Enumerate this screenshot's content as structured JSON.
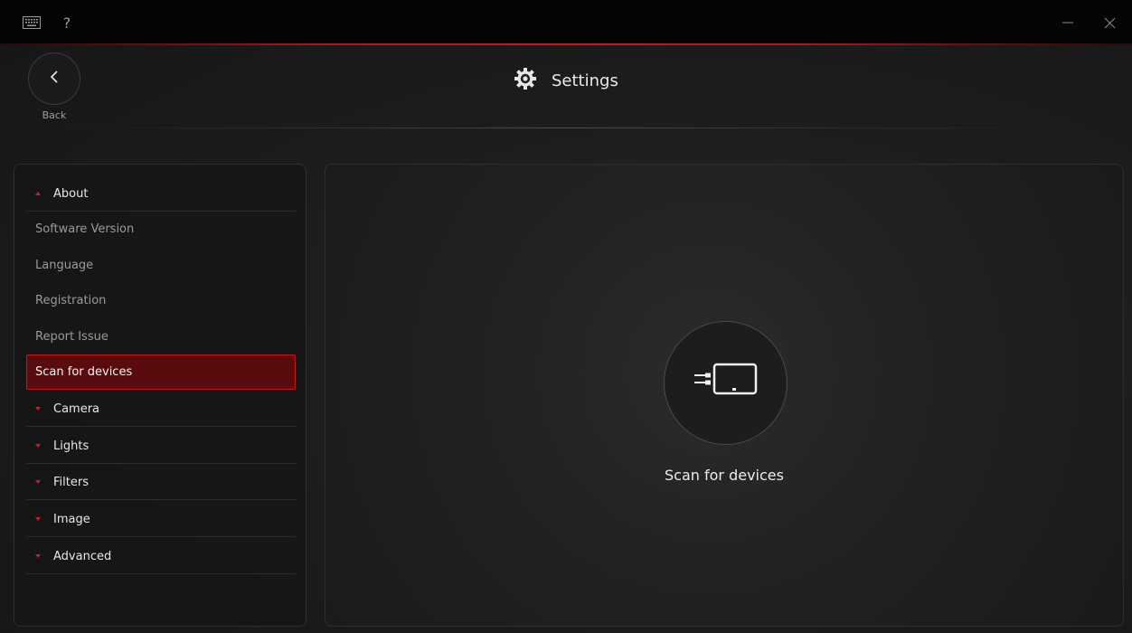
{
  "titlebar": {
    "keyboard_icon": "keyboard-icon",
    "help_glyph": "?",
    "accent_color": "#c81b22"
  },
  "header": {
    "back_label": "Back",
    "title": "Settings"
  },
  "sidebar": {
    "items": [
      {
        "label": "About",
        "kind": "section",
        "expanded": true
      },
      {
        "label": "Software Version",
        "kind": "sub"
      },
      {
        "label": "Language",
        "kind": "sub"
      },
      {
        "label": "Registration",
        "kind": "sub"
      },
      {
        "label": "Report Issue",
        "kind": "sub"
      },
      {
        "label": "Scan for devices",
        "kind": "sub",
        "active": true
      },
      {
        "label": "Camera",
        "kind": "section",
        "expanded": false
      },
      {
        "label": "Lights",
        "kind": "section",
        "expanded": false
      },
      {
        "label": "Filters",
        "kind": "section",
        "expanded": false
      },
      {
        "label": "Image",
        "kind": "section",
        "expanded": false
      },
      {
        "label": "Advanced",
        "kind": "section",
        "expanded": false
      }
    ]
  },
  "main": {
    "scan_label": "Scan for devices",
    "scan_icon": "device-scan-icon"
  },
  "colors": {
    "accent": "#c81b22",
    "active_bg": "#5a0b0e",
    "panel_border": "#2e2e2e"
  }
}
